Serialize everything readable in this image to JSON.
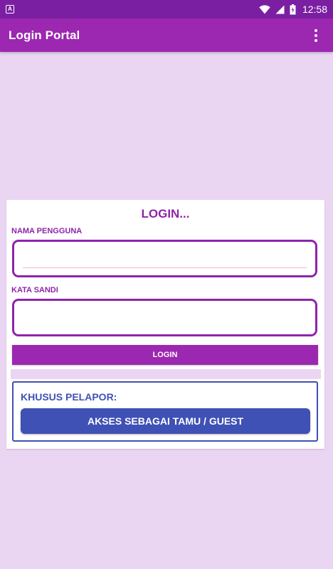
{
  "status_bar": {
    "notification_icon": "A",
    "time": "12:58",
    "icons": [
      "wifi-icon",
      "signal-icon",
      "battery-icon"
    ]
  },
  "app_bar": {
    "title": "Login Portal",
    "menu_icon": "overflow-menu-icon"
  },
  "login_card": {
    "title": "LOGIN...",
    "username_label": "NAMA PENGGUNA",
    "username_value": "",
    "password_label": "KATA SANDI",
    "password_value": "",
    "login_button": "LOGIN"
  },
  "guest_section": {
    "label": "KHUSUS PELAPOR:",
    "button": "AKSES SEBAGAI TAMU / GUEST"
  },
  "colors": {
    "status_bar": "#7b1fa2",
    "app_bar": "#9c27b0",
    "background": "#ead6f2",
    "accent": "#8e24aa",
    "guest": "#3f51b5"
  }
}
